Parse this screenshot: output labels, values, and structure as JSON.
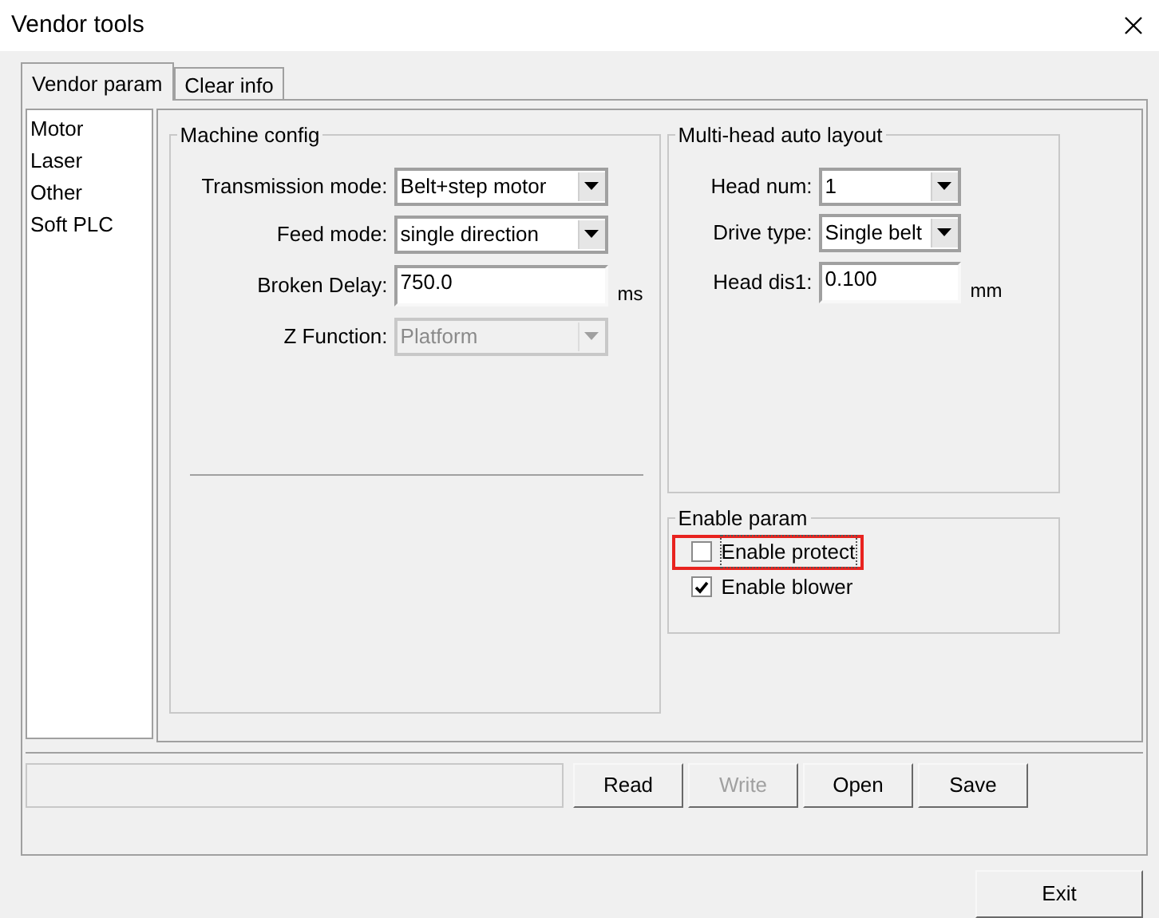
{
  "window": {
    "title": "Vendor tools"
  },
  "tabs": [
    {
      "label": "Vendor param",
      "selected": true
    },
    {
      "label": "Clear info",
      "selected": false
    }
  ],
  "sidebar": {
    "items": [
      "Motor",
      "Laser",
      "Other",
      "Soft PLC"
    ]
  },
  "machine_config": {
    "title": "Machine config",
    "fields": [
      {
        "kind": "select",
        "label": "Transmission mode:",
        "value": "Belt+step motor",
        "disabled": false
      },
      {
        "kind": "select",
        "label": "Feed mode:",
        "value": "single direction",
        "disabled": false
      },
      {
        "kind": "input",
        "label": "Broken Delay:",
        "value": "750.0",
        "unit": "ms"
      },
      {
        "kind": "select",
        "label": "Z Function:",
        "value": "Platform",
        "disabled": true
      }
    ]
  },
  "multi_head": {
    "title": "Multi-head auto layout",
    "fields": [
      {
        "kind": "select",
        "label": "Head num:",
        "value": "1",
        "disabled": false
      },
      {
        "kind": "select",
        "label": "Drive type:",
        "value": "Single belt",
        "disabled": false
      },
      {
        "kind": "input",
        "label": "Head dis1:",
        "value": "0.100",
        "unit": "mm"
      }
    ]
  },
  "enable_param": {
    "title": "Enable param",
    "checkboxes": [
      {
        "label": "Enable protect",
        "checked": false,
        "highlighted": true
      },
      {
        "label": "Enable blower",
        "checked": true,
        "highlighted": false
      }
    ]
  },
  "actions": [
    {
      "label": "Read",
      "disabled": false
    },
    {
      "label": "Write",
      "disabled": true
    },
    {
      "label": "Open",
      "disabled": false
    },
    {
      "label": "Save",
      "disabled": false
    }
  ],
  "exit_button": "Exit"
}
